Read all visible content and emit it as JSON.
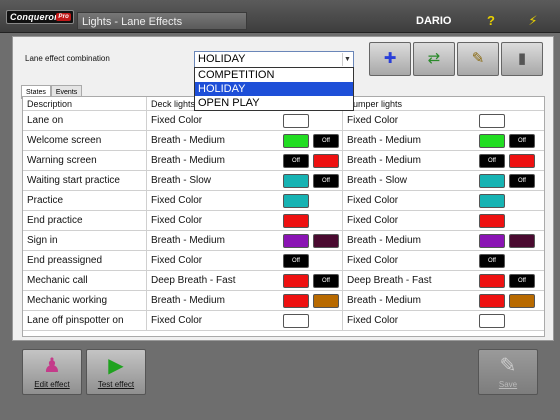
{
  "app": {
    "logo_text": "Conqueror",
    "logo_badge": "Pro",
    "title": "Lights - Lane Effects",
    "user": "DARIO",
    "help_glyph": "?",
    "lightning_glyph": "⚡"
  },
  "combo": {
    "label": "Lane effect combination",
    "value": "HOLIDAY",
    "options": [
      "COMPETITION",
      "HOLIDAY",
      "OPEN PLAY"
    ],
    "selected_option": "HOLIDAY"
  },
  "toolbar": {
    "add_icon": "plus-icon",
    "copy_icon": "copy-icon",
    "edit_icon": "edit-icon",
    "delete_icon": "trash-icon"
  },
  "tabs": [
    "States",
    "Events"
  ],
  "table": {
    "headers": [
      "Description",
      "Deck lights",
      "Bumper lights"
    ],
    "rows": [
      {
        "desc": "Lane on",
        "deck": "Fixed Color",
        "deck_colors": [
          "#ffffff"
        ],
        "bump": "Fixed Color",
        "bump_colors": [
          "#ffffff"
        ]
      },
      {
        "desc": "Welcome screen",
        "deck": "Breath - Medium",
        "deck_colors": [
          "#22dd22",
          "off"
        ],
        "bump": "Breath - Medium",
        "bump_colors": [
          "#22dd22",
          "off"
        ]
      },
      {
        "desc": "Warning screen",
        "deck": "Breath - Medium",
        "deck_colors": [
          "off",
          "#ee1111"
        ],
        "bump": "Breath - Medium",
        "bump_colors": [
          "off",
          "#ee1111"
        ]
      },
      {
        "desc": "Waiting start practice",
        "deck": "Breath - Slow",
        "deck_colors": [
          "#17b3b3",
          "off"
        ],
        "bump": "Breath - Slow",
        "bump_colors": [
          "#17b3b3",
          "off"
        ]
      },
      {
        "desc": "Practice",
        "deck": "Fixed Color",
        "deck_colors": [
          "#17b3b3"
        ],
        "bump": "Fixed Color",
        "bump_colors": [
          "#17b3b3"
        ]
      },
      {
        "desc": "End practice",
        "deck": "Fixed Color",
        "deck_colors": [
          "#ee1111"
        ],
        "bump": "Fixed Color",
        "bump_colors": [
          "#ee1111"
        ]
      },
      {
        "desc": "Sign in",
        "deck": "Breath - Medium",
        "deck_colors": [
          "#8a14b4",
          "#4a0a30"
        ],
        "bump": "Breath - Medium",
        "bump_colors": [
          "#8a14b4",
          "#4a0a30"
        ]
      },
      {
        "desc": "End preassigned",
        "deck": "Fixed Color",
        "deck_colors": [
          "off"
        ],
        "bump": "Fixed Color",
        "bump_colors": [
          "off"
        ]
      },
      {
        "desc": "Mechanic call",
        "deck": "Deep Breath - Fast",
        "deck_colors": [
          "#ee1111",
          "off"
        ],
        "bump": "Deep Breath - Fast",
        "bump_colors": [
          "#ee1111",
          "off"
        ]
      },
      {
        "desc": "Mechanic working",
        "deck": "Breath - Medium",
        "deck_colors": [
          "#ee1111",
          "#b86a00"
        ],
        "bump": "Breath - Medium",
        "bump_colors": [
          "#ee1111",
          "#b86a00"
        ]
      },
      {
        "desc": "Lane off pinspotter on",
        "deck": "Fixed Color",
        "deck_colors": [
          "#ffffff"
        ],
        "bump": "Fixed Color",
        "bump_colors": [
          "#ffffff"
        ]
      }
    ],
    "off_label": "Off"
  },
  "footer": {
    "edit_label": "Edit effect",
    "test_label": "Test effect",
    "save_label": "Save"
  }
}
